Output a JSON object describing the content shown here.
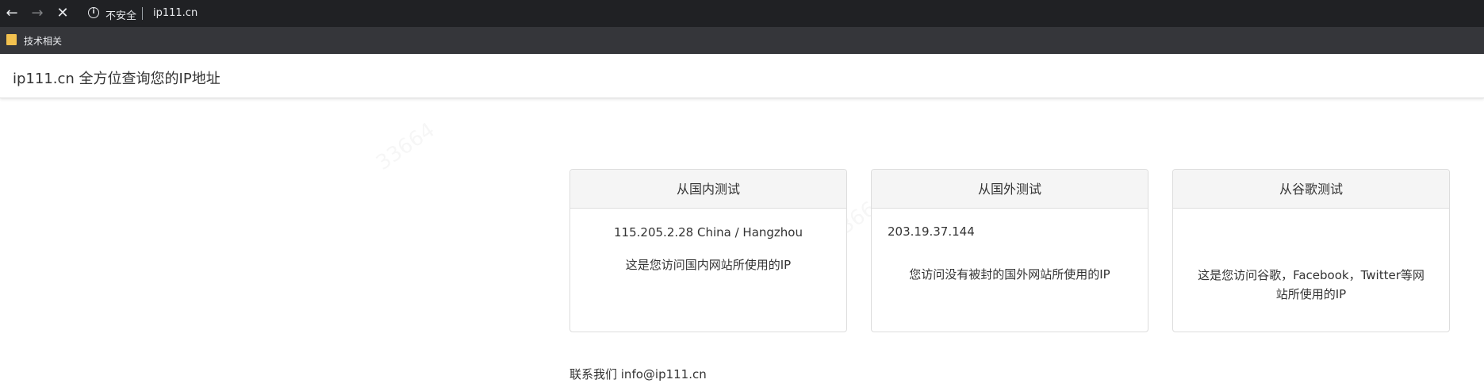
{
  "browser": {
    "security_label": "不安全",
    "url": "ip111.cn",
    "bookmark_label": "技术相关"
  },
  "page": {
    "title": "ip111.cn 全方位查询您的IP地址"
  },
  "panels": [
    {
      "heading": "从国内测试",
      "ip": "115.205.2.28 China / Hangzhou",
      "description": "这是您访问国内网站所使用的IP"
    },
    {
      "heading": "从国外测试",
      "ip": "203.19.37.144",
      "description": "您访问没有被封的国外网站所使用的IP"
    },
    {
      "heading": "从谷歌测试",
      "ip": "",
      "description": "这是您访问谷歌，Facebook，Twitter等网站所使用的IP"
    }
  ],
  "footer": {
    "contact": "联系我们 info@ip111.cn"
  }
}
